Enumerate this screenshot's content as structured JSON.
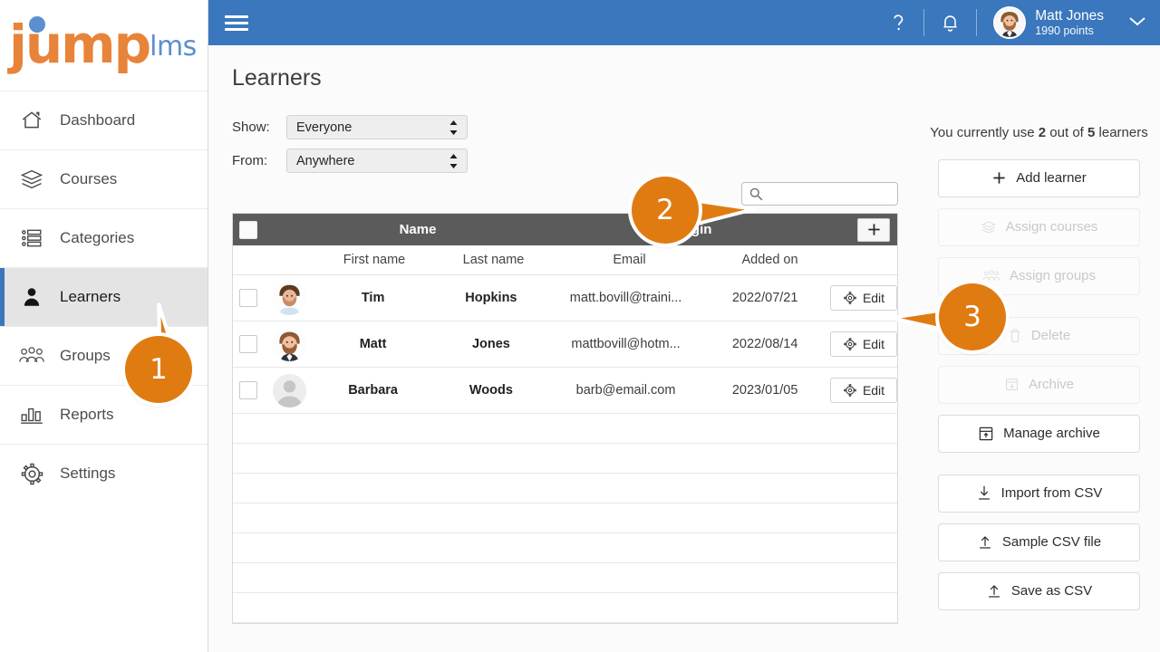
{
  "brand": {
    "name_primary": "jump",
    "name_secondary": "lms",
    "color_orange": "#e8833a",
    "color_blue": "#5b8fce"
  },
  "topbar": {
    "menu_icon": "hamburger-icon",
    "help_icon": "question-mark-icon",
    "notifications_icon": "bell-icon",
    "user_name": "Matt Jones",
    "user_points": "1990 points",
    "chevron_icon": "chevron-down-icon",
    "background_color": "#3a77bd"
  },
  "page": {
    "title": "Learners"
  },
  "sidebar": {
    "items": [
      {
        "label": "Dashboard",
        "icon": "home-icon",
        "active": false
      },
      {
        "label": "Courses",
        "icon": "books-icon",
        "active": false
      },
      {
        "label": "Categories",
        "icon": "list-icon",
        "active": false
      },
      {
        "label": "Learners",
        "icon": "person-icon",
        "active": true
      },
      {
        "label": "Groups",
        "icon": "people-icon",
        "active": false
      },
      {
        "label": "Reports",
        "icon": "bar-chart-icon",
        "active": false
      },
      {
        "label": "Settings",
        "icon": "gear-icon",
        "active": false
      }
    ]
  },
  "filters": {
    "show_label": "Show:",
    "show_value": "Everyone",
    "from_label": "From:",
    "from_value": "Anywhere"
  },
  "search": {
    "value": "",
    "placeholder": "",
    "icon": "search-icon"
  },
  "table": {
    "group_headers": {
      "name": "Name",
      "login": "Login"
    },
    "add_column_icon": "plus-icon",
    "columns": [
      "First name",
      "Last name",
      "Email",
      "Added on"
    ],
    "rows": [
      {
        "avatar": "avatar-male-beard-blue",
        "first": "Tim",
        "last": "Hopkins",
        "email": "matt.bovill@traini...",
        "added": "2022/07/21",
        "edit_label": "Edit",
        "edit_icon": "gear-icon"
      },
      {
        "avatar": "avatar-male-beard-suit",
        "first": "Matt",
        "last": "Jones",
        "email": "mattbovill@hotm...",
        "added": "2022/08/14",
        "edit_label": "Edit",
        "edit_icon": "gear-icon"
      },
      {
        "avatar": "avatar-placeholder",
        "first": "Barbara",
        "last": "Woods",
        "email": "barb@email.com",
        "added": "2023/01/05",
        "edit_label": "Edit",
        "edit_icon": "gear-icon"
      }
    ],
    "empty_row_count": 7
  },
  "right_panel": {
    "quota_prefix": "You currently use ",
    "quota_used": "2",
    "quota_middle": " out of ",
    "quota_total": "5",
    "quota_suffix": " learners",
    "buttons": [
      {
        "label": "Add learner",
        "icon": "plus-icon",
        "disabled": false,
        "gap_before": false
      },
      {
        "label": "Assign courses",
        "icon": "books-icon",
        "disabled": true,
        "gap_before": false
      },
      {
        "label": "Assign groups",
        "icon": "people-icon",
        "disabled": true,
        "gap_before": false
      },
      {
        "label": "Delete",
        "icon": "trash-icon",
        "disabled": true,
        "gap_before": true
      },
      {
        "label": "Archive",
        "icon": "archive-in-icon",
        "disabled": true,
        "gap_before": false
      },
      {
        "label": "Manage archive",
        "icon": "archive-box-icon",
        "disabled": false,
        "gap_before": false
      },
      {
        "label": "Import from CSV",
        "icon": "download-icon",
        "disabled": false,
        "gap_before": true
      },
      {
        "label": "Sample CSV file",
        "icon": "upload-icon",
        "disabled": false,
        "gap_before": false
      },
      {
        "label": "Save as CSV",
        "icon": "upload-icon",
        "disabled": false,
        "gap_before": false
      }
    ]
  },
  "callouts": [
    {
      "number": "1",
      "color": "#e07b12"
    },
    {
      "number": "2",
      "color": "#e07b12"
    },
    {
      "number": "3",
      "color": "#e07b12"
    }
  ]
}
